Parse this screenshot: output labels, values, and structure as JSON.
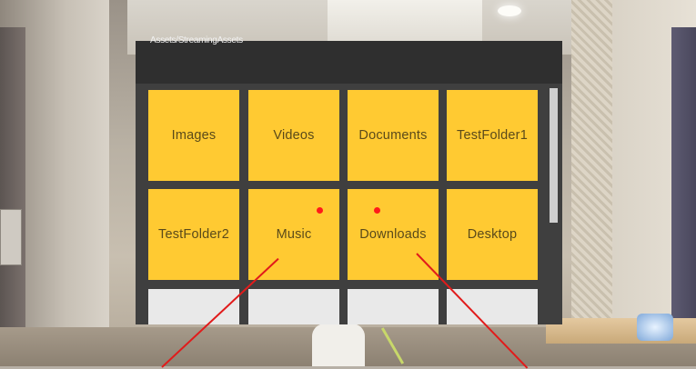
{
  "panel": {
    "path": "Assets/StreamingAssets",
    "folders": [
      {
        "name": "Images"
      },
      {
        "name": "Videos"
      },
      {
        "name": "Documents"
      },
      {
        "name": "TestFolder1"
      },
      {
        "name": "TestFolder2"
      },
      {
        "name": "Music"
      },
      {
        "name": "Downloads"
      },
      {
        "name": "Desktop"
      }
    ],
    "files": [
      {
        "name": ""
      },
      {
        "name": ""
      },
      {
        "name": ""
      },
      {
        "name": ""
      }
    ],
    "colors": {
      "folder_tile": "#ffca32",
      "file_tile": "#e9e9e9",
      "panel_bg": "#3f3f3f",
      "pointer": "#e11b1b"
    }
  }
}
